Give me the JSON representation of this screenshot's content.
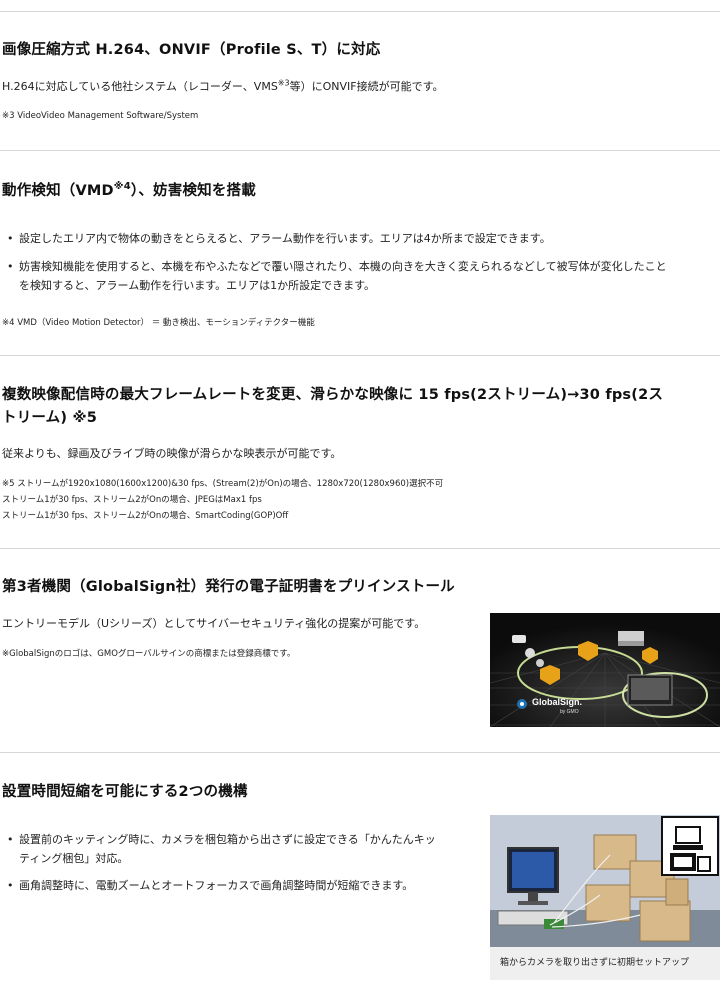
{
  "s1": {
    "heading": "画像圧縮方式 H.264、ONVIF（Profile S、T）に対応",
    "body_pre": "H.264に対応している他社システム（レコーダー、VMS",
    "body_sup": "※3",
    "body_post": "等）にONVIF接続が可能です。",
    "note": "※3 VideoVideo Management Software/System"
  },
  "s2": {
    "heading_pre": "動作検知（VMD",
    "heading_sup": "※4",
    "heading_post": "）、妨害検知を搭載",
    "bullets": [
      "設定したエリア内で物体の動きをとらえると、アラーム動作を行います。エリアは4か所まで設定できます。",
      "妨害検知機能を使用すると、本機を布やふたなどで覆い隠されたり、本機の向きを大きく変えられるなどして被写体が変化したこと",
      "を検知すると、アラーム動作を行います。エリアは1か所設定できます。"
    ],
    "note": "※4 VMD（Video Motion Detector） ＝ 動き検出、モーションディテクター機能"
  },
  "s3": {
    "heading_line1": "複数映像配信時の最大フレームレートを変更、滑らかな映像に 15 fps(2ストリーム)→30 fps(2ス",
    "heading_line2": "トリーム) ※5",
    "body": "従来よりも、録画及びライブ時の映像が滑らかな映表示が可能です。",
    "notes": [
      "※5 ストリームが1920x1080(1600x1200)&30 fps、(Stream(2)がOn)の場合、1280x720(1280x960)選択不可",
      "ストリーム1が30 fps、ストリーム2がOnの場合、JPEGはMax1 fps",
      "ストリーム1が30 fps、ストリーム2がOnの場合、SmartCoding(GOP)Off"
    ]
  },
  "s4": {
    "heading": "第3者機関（GlobalSign社）発行の電子証明書をプリインストール",
    "body": "エントリーモデル（Uシリーズ）としてサイバーセキュリティ強化の提案が可能です。",
    "note": "※GlobalSignのロゴは、GMOグローバルサインの商標または登録商標です。",
    "image_logo": "GlobalSign.",
    "image_logo_sub": "by GMO"
  },
  "s5": {
    "heading": "設置時間短縮を可能にする2つの機構",
    "bullets": [
      "設置前のキッティング時に、カメラを梱包箱から出さずに設定できる「かんたんキッ",
      "ティング梱包」対応。",
      "画角調整時に、電動ズームとオートフォーカスで画角調整時間が短縮できます。"
    ],
    "image_caption": "箱からカメラを取り出さずに初期セットアップ"
  },
  "colors": {
    "rule": "#d8d8d8",
    "caption_bg": "#efefef",
    "shield": "#e8a21a"
  }
}
